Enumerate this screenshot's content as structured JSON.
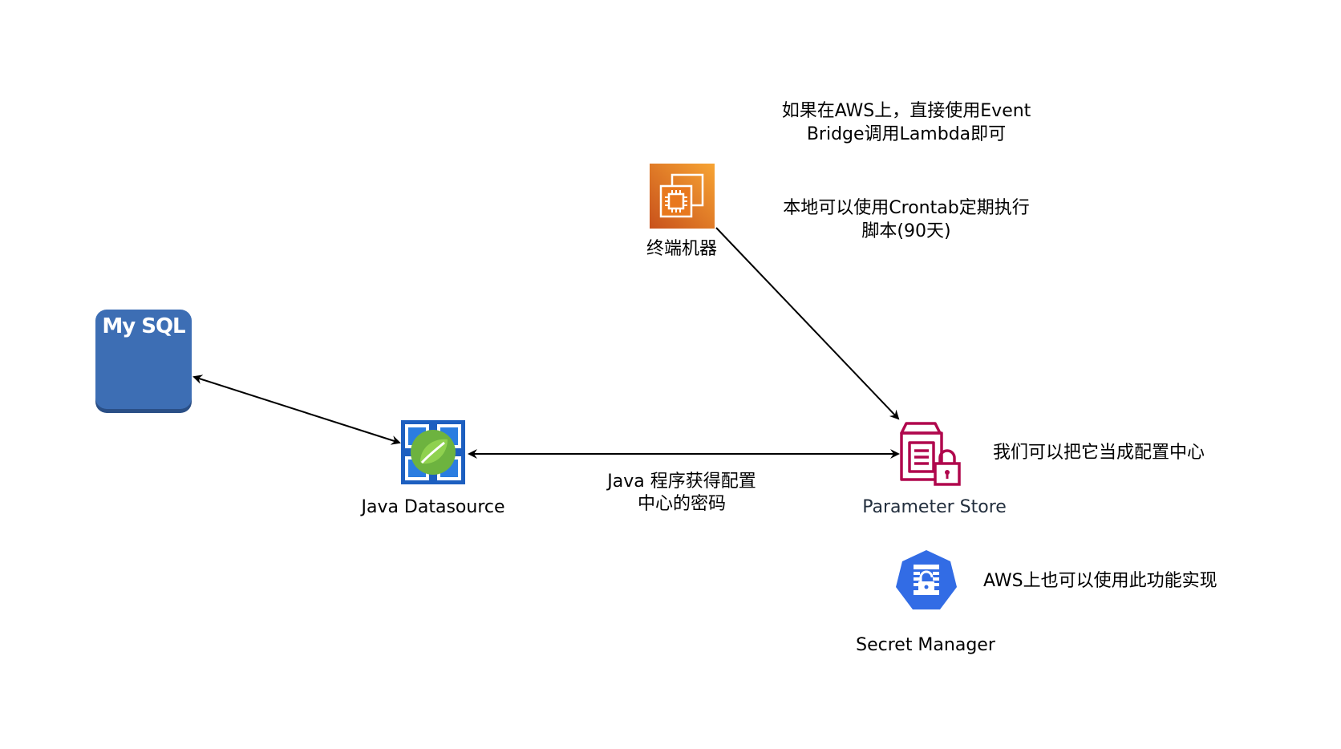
{
  "nodes": {
    "mysql": {
      "label": "My SQL",
      "color": "#3d6eb4",
      "icon": "database-icon"
    },
    "java_datasource": {
      "label": "Java Datasource",
      "icon": "spring-leaf-icon"
    },
    "terminal": {
      "label": "终端机器",
      "icon": "ec2-instance-icon",
      "color": "#e8781e"
    },
    "parameter_store": {
      "label": "Parameter Store",
      "icon": "parameter-store-lock-icon",
      "color": "#b0084d"
    },
    "secret_manager": {
      "label": "Secret Manager",
      "icon": "secret-manager-icon",
      "color": "#326ce5"
    }
  },
  "notes": {
    "aws_line1": "如果在AWS上，直接使用Event",
    "aws_line2": "Bridge调用Lambda即可",
    "local_line1": "本地可以使用Crontab定期执行",
    "local_line2": "脚本(90天)",
    "config_center": "我们可以把它当成配置中心",
    "aws_alt": "AWS上也可以使用此功能实现"
  },
  "edges": {
    "java_to_store_line1": "Java 程序获得配置",
    "java_to_store_line2": "中心的密码"
  }
}
